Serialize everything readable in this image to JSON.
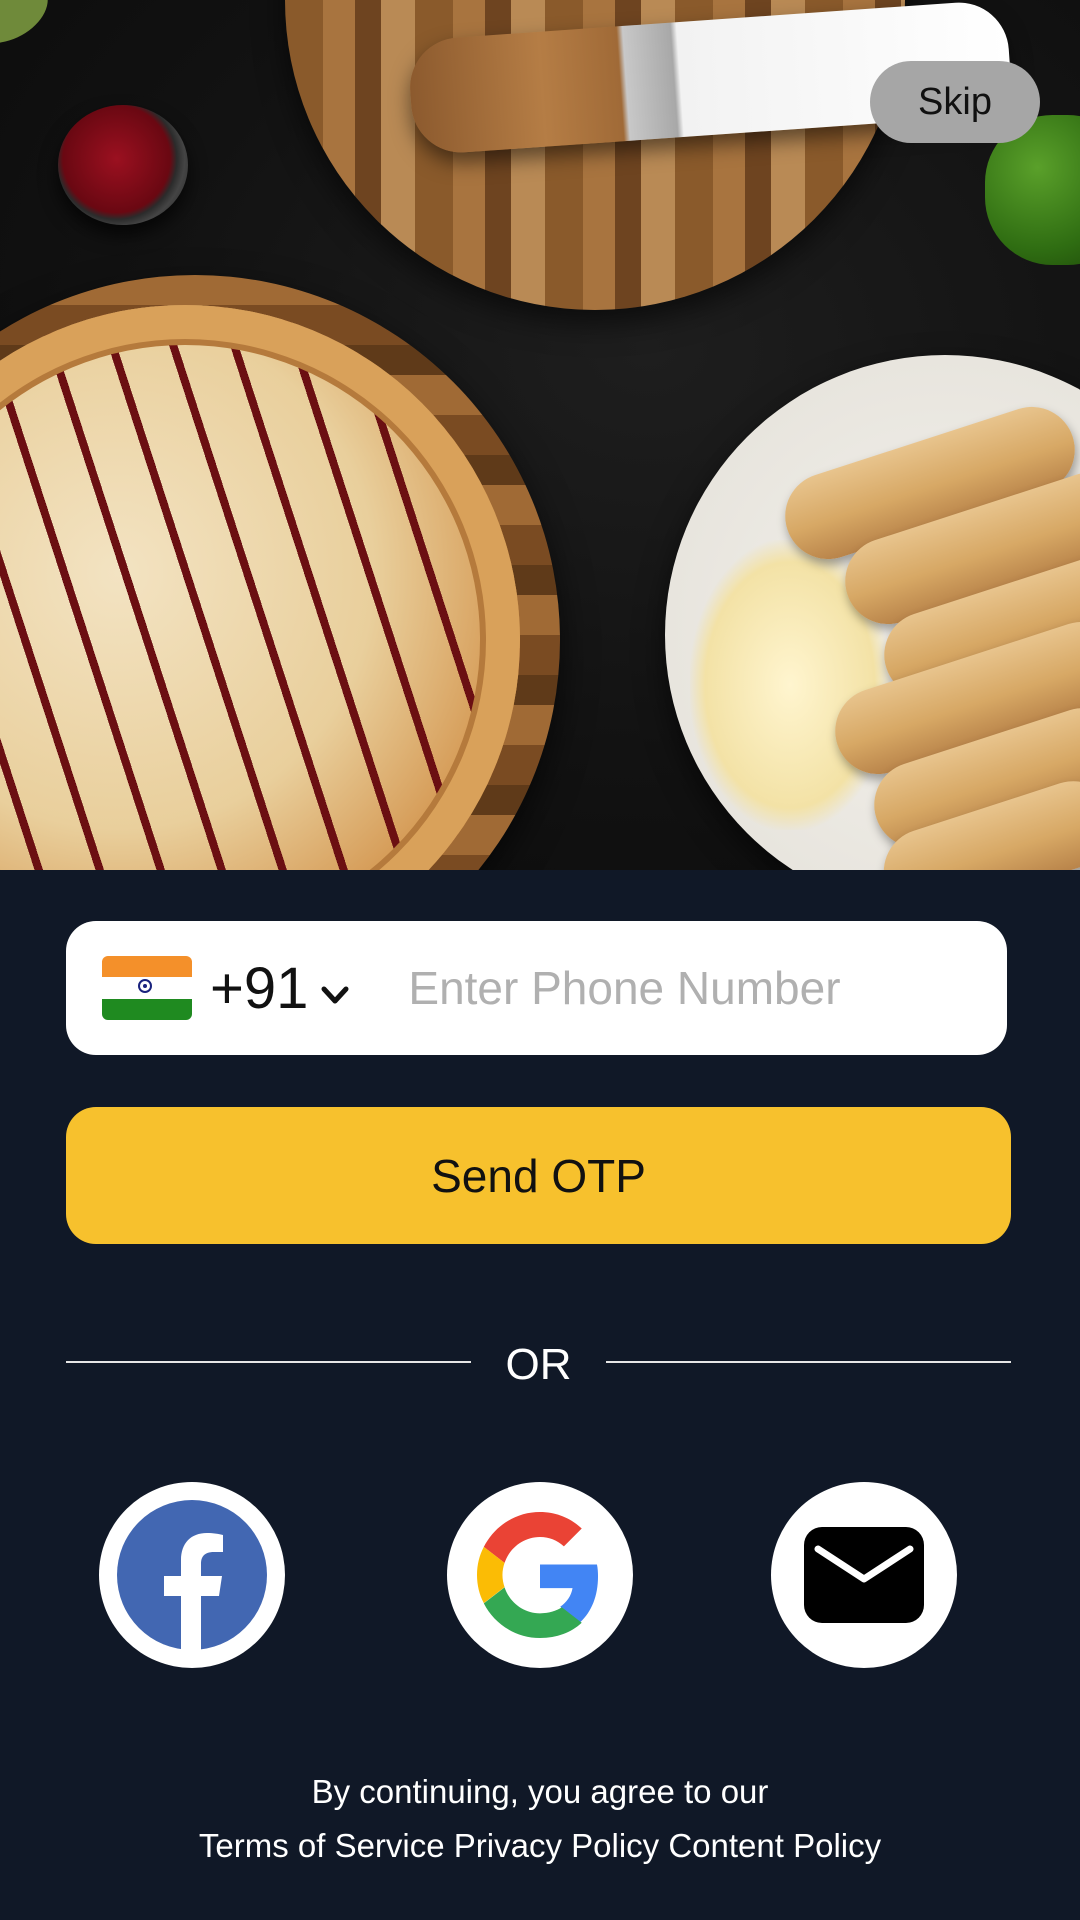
{
  "header": {
    "skip_label": "Skip"
  },
  "hero": {
    "image_name": "food-banner-image"
  },
  "phone": {
    "country_flag": "india-flag-icon",
    "country_code": "+91",
    "dropdown_icon": "chevron-down-icon",
    "placeholder": "Enter Phone Number",
    "value": ""
  },
  "otp_button": {
    "label": "Send OTP",
    "color": "#f7c12d"
  },
  "divider": {
    "label": "OR"
  },
  "social": [
    {
      "icon": "facebook-icon",
      "color": "#4267b2"
    },
    {
      "icon": "google-icon",
      "colors": [
        "#ea4335",
        "#fbbc05",
        "#34a853",
        "#4285f4"
      ]
    },
    {
      "icon": "mail-icon",
      "color": "#000000"
    }
  ],
  "footer": {
    "agree_text": "By continuing, you agree to our",
    "links": [
      "Terms of Service",
      "Privacy Policy",
      "Content Policy"
    ]
  },
  "theme": {
    "background": "#101827"
  }
}
